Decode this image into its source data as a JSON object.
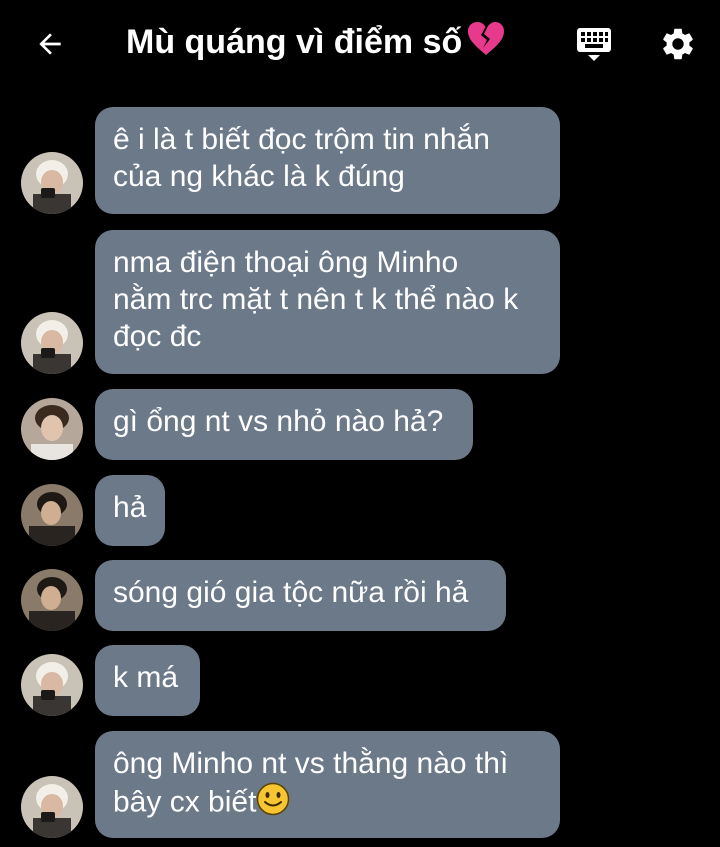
{
  "header": {
    "title": "Mù quáng vì điểm số",
    "title_emoji": "broken-heart-icon"
  },
  "messages": [
    {
      "avatar": "avatar-blond",
      "text": "ê i là t biết đọc trộm tin nhắn\ncủa ng khác là k đúng"
    },
    {
      "avatar": "avatar-blond",
      "text": "nma điện thoại ông Minho\nnằm trc mặt t nên t k thể nào k\nđọc đc"
    },
    {
      "avatar": "avatar-brown",
      "text": "gì ổng nt vs nhỏ nào hả?"
    },
    {
      "avatar": "avatar-dark",
      "text": "hả"
    },
    {
      "avatar": "avatar-dark",
      "text": "sóng gió gia tộc nữa rồi hả"
    },
    {
      "avatar": "avatar-blond",
      "text": "k má"
    },
    {
      "avatar": "avatar-blond",
      "text": "ông Minho nt vs thằng nào thì\nbây cx biết",
      "trailing_emoji": "smiley-icon"
    }
  ],
  "colors": {
    "background": "#000000",
    "bubble": "#6b7988",
    "text": "#ffffff",
    "heart": "#e83a8c"
  }
}
